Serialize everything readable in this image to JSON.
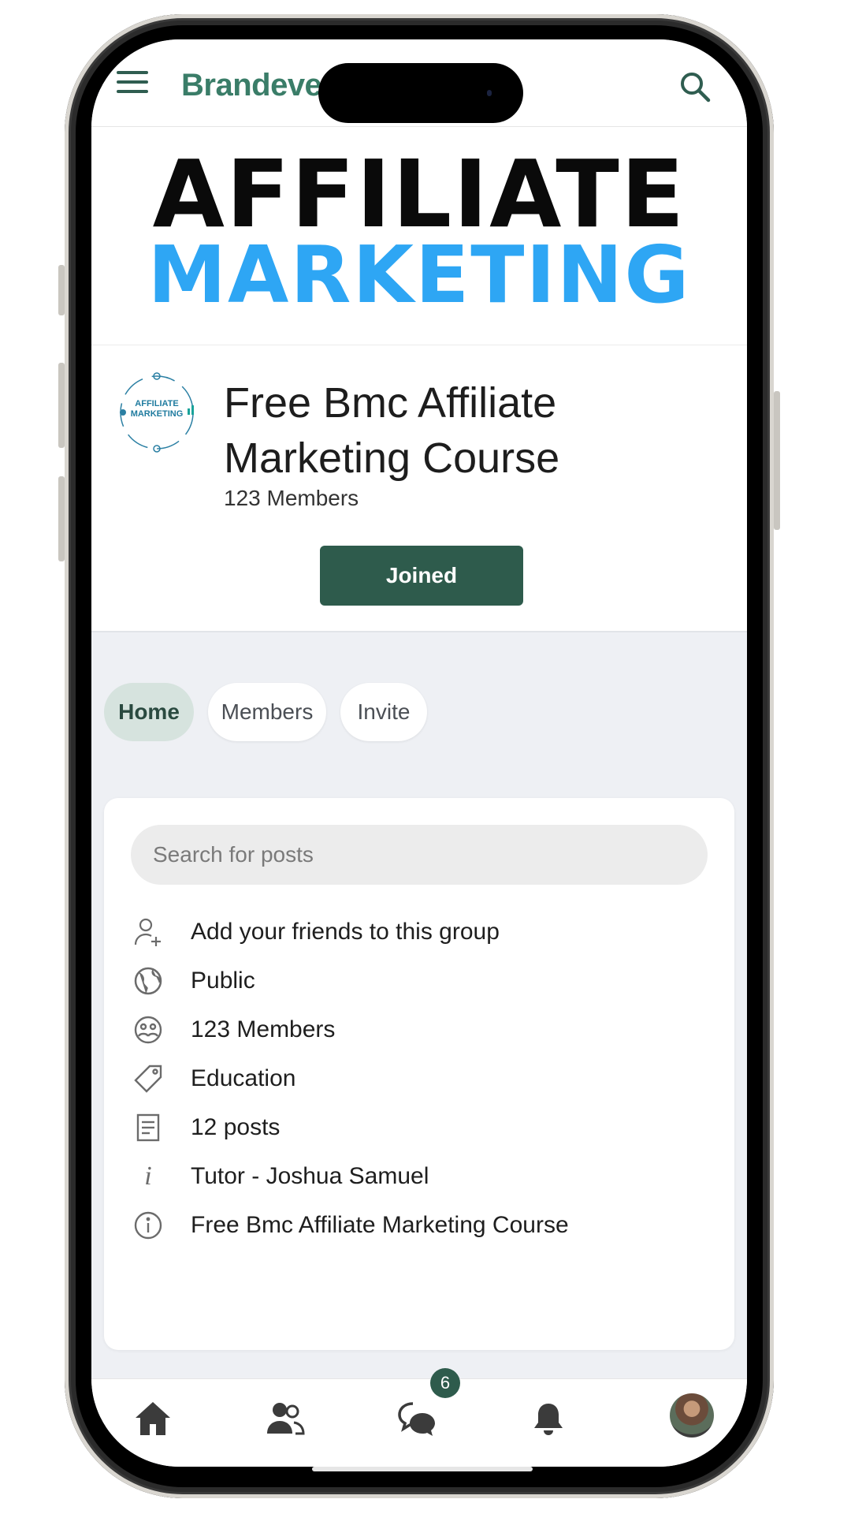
{
  "header": {
    "brand": "Brandeve",
    "menu_icon": "hamburger-menu-icon",
    "search_icon": "search-icon"
  },
  "cover": {
    "line1": "AFFILIATE",
    "line2": "MARKETING"
  },
  "group": {
    "logo_text_line1": "AFFILIATE",
    "logo_text_line2": "MARKETING",
    "title": "Free Bmc Affiliate Marketing Course",
    "members": "123 Members",
    "join_button": "Joined"
  },
  "tabs": [
    {
      "label": "Home",
      "active": true
    },
    {
      "label": "Members",
      "active": false
    },
    {
      "label": "Invite",
      "active": false
    }
  ],
  "details": {
    "search_placeholder": "Search for posts",
    "rows": [
      {
        "icon": "add-person-icon",
        "text": "Add your friends to this group"
      },
      {
        "icon": "globe-icon",
        "text": "Public"
      },
      {
        "icon": "members-icon",
        "text": "123 Members"
      },
      {
        "icon": "tag-icon",
        "text": "Education"
      },
      {
        "icon": "document-icon",
        "text": "12 posts"
      },
      {
        "icon": "italic-info-icon",
        "text": "Tutor - Joshua Samuel"
      },
      {
        "icon": "info-circle-icon",
        "text": "Free Bmc Affiliate Marketing Course"
      }
    ]
  },
  "bottom_nav": {
    "items": [
      "home-icon",
      "friends-icon",
      "chat-icon",
      "bell-icon",
      "avatar"
    ],
    "chat_badge": "6"
  },
  "colors": {
    "brand_green": "#2e5b4c",
    "cover_blue": "#2ea6f4",
    "active_tab": "#d6e3de"
  }
}
